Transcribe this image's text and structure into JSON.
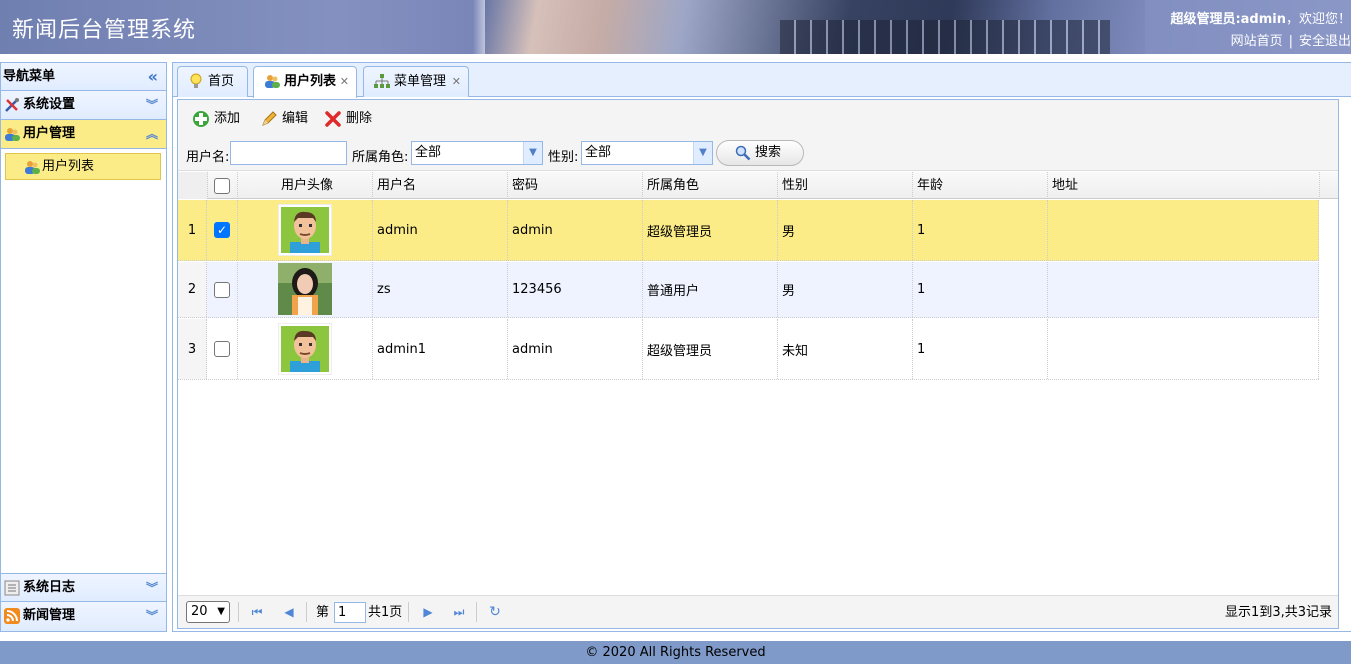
{
  "header": {
    "title": "新闻后台管理系统",
    "welcome_user": "超级管理员:admin",
    "welcome_text": "，欢迎您！",
    "link_home": "网站首页",
    "link_sep": "|",
    "link_logout": "安全退出"
  },
  "sidebar": {
    "title": "导航菜单",
    "accordion": [
      {
        "label": "系统设置",
        "icon": "tools-icon"
      },
      {
        "label": "用户管理",
        "icon": "users-icon",
        "active": true,
        "items": [
          {
            "label": "用户列表",
            "icon": "users-icon"
          }
        ]
      },
      {
        "label": "系统日志",
        "icon": "log-icon"
      },
      {
        "label": "新闻管理",
        "icon": "rss-icon"
      }
    ]
  },
  "tabs": [
    {
      "label": "首页",
      "icon": "lightbulb-icon",
      "closable": false
    },
    {
      "label": "用户列表",
      "icon": "users-icon",
      "closable": true,
      "active": true
    },
    {
      "label": "菜单管理",
      "icon": "sitemap-icon",
      "closable": true
    }
  ],
  "toolbar": {
    "add": "添加",
    "edit": "编辑",
    "delete": "删除"
  },
  "filter": {
    "username_label": "用户名:",
    "username_value": "",
    "role_label": "所属角色:",
    "role_value": "全部",
    "gender_label": "性别:",
    "gender_value": "全部",
    "search_label": "搜索"
  },
  "grid": {
    "columns": [
      "用户头像",
      "用户名",
      "密码",
      "所属角色",
      "性别",
      "年龄",
      "地址"
    ],
    "rows": [
      {
        "num": "1",
        "checked": true,
        "avatar": "cartoon-man",
        "username": "admin",
        "password": "admin",
        "role": "超级管理员",
        "gender": "男",
        "age": "1",
        "address": ""
      },
      {
        "num": "2",
        "checked": false,
        "avatar": "photo-woman",
        "username": "zs",
        "password": "123456",
        "role": "普通用户",
        "gender": "男",
        "age": "1",
        "address": ""
      },
      {
        "num": "3",
        "checked": false,
        "avatar": "cartoon-man",
        "username": "admin1",
        "password": "admin",
        "role": "超级管理员",
        "gender": "未知",
        "age": "1",
        "address": ""
      }
    ]
  },
  "pager": {
    "page_size": "20",
    "page_prefix": "第",
    "page_value": "1",
    "page_total": "共1页",
    "summary": "显示1到3,共3记录"
  },
  "footer": {
    "copyright": "© 2020 All Rights Reserved"
  },
  "colors": {
    "selected_row": "#fbec88",
    "border": "#95b8e7",
    "panel_header": "#e0ecff",
    "footer": "#7f9ac8"
  }
}
